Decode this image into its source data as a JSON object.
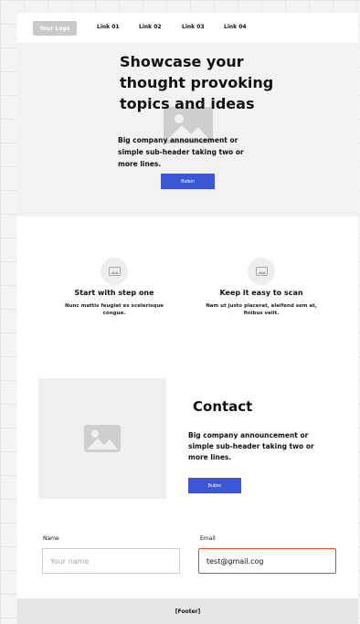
{
  "nav": {
    "logo": "Your Logo",
    "links": [
      "Link 01",
      "Link 02",
      "Link 03",
      "Link 04"
    ]
  },
  "hero": {
    "title": "Showcase your thought provoking topics and ideas",
    "subheader": "Big company announcement or simple sub-header taking two or more lines.",
    "button": "Button"
  },
  "features": [
    {
      "title": "Start with step one",
      "description": "Nunc mattis feugiat ex scelerisque congue.",
      "icon": "image-icon"
    },
    {
      "title": "Keep it easy to scan",
      "description": "Nam ut justo placerat, eleifend sem at, finibus velit.",
      "icon": "image-icon"
    }
  ],
  "contact": {
    "title": "Contact",
    "subheader": "Big company announcement or simple sub-header taking two or more lines.",
    "button": "Button",
    "icon": "image-icon"
  },
  "form": {
    "name_label": "Name",
    "name_placeholder": "Your name",
    "email_label": "Email",
    "email_value": "test@gmail.cog"
  },
  "footer": {
    "label": "[Footer]"
  },
  "colors": {
    "accent": "#3b57d6",
    "error": "#e5452f"
  }
}
